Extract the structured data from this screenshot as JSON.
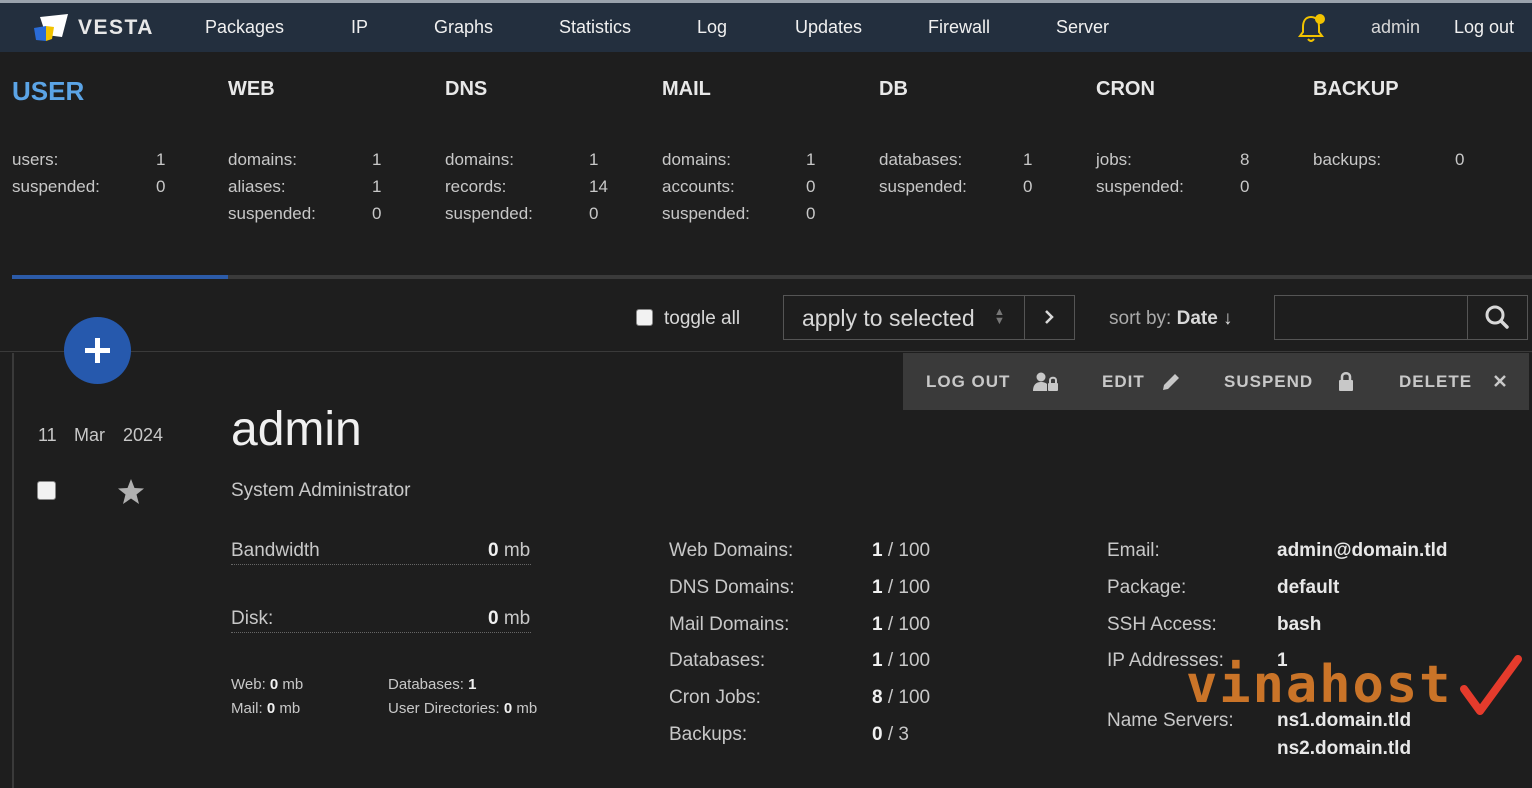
{
  "nav": {
    "logo_text": "VESTA",
    "items": [
      "Packages",
      "IP",
      "Graphs",
      "Statistics",
      "Log",
      "Updates",
      "Firewall",
      "Server"
    ],
    "user": "admin",
    "logout": "Log out"
  },
  "stats": {
    "user": {
      "title": "USER",
      "rows": [
        {
          "label": "users:",
          "value": "1"
        },
        {
          "label": "suspended:",
          "value": "0"
        }
      ]
    },
    "web": {
      "title": "WEB",
      "rows": [
        {
          "label": "domains:",
          "value": "1"
        },
        {
          "label": "aliases:",
          "value": "1"
        },
        {
          "label": "suspended:",
          "value": "0"
        }
      ]
    },
    "dns": {
      "title": "DNS",
      "rows": [
        {
          "label": "domains:",
          "value": "1"
        },
        {
          "label": "records:",
          "value": "14"
        },
        {
          "label": "suspended:",
          "value": "0"
        }
      ]
    },
    "mail": {
      "title": "MAIL",
      "rows": [
        {
          "label": "domains:",
          "value": "1"
        },
        {
          "label": "accounts:",
          "value": "0"
        },
        {
          "label": "suspended:",
          "value": "0"
        }
      ]
    },
    "db": {
      "title": "DB",
      "rows": [
        {
          "label": "databases:",
          "value": "1"
        },
        {
          "label": "suspended:",
          "value": "0"
        }
      ]
    },
    "cron": {
      "title": "CRON",
      "rows": [
        {
          "label": "jobs:",
          "value": "8"
        },
        {
          "label": "suspended:",
          "value": "0"
        }
      ]
    },
    "backup": {
      "title": "BACKUP",
      "rows": [
        {
          "label": "backups:",
          "value": "0"
        }
      ]
    }
  },
  "toolbar": {
    "toggle_all": "toggle all",
    "apply_selected": "apply to selected",
    "sort_prefix": "sort by:",
    "sort_field": "Date ↓",
    "search_placeholder": ""
  },
  "actions": {
    "logout": "LOG OUT",
    "edit": "EDIT",
    "suspend": "SUSPEND",
    "delete": "DELETE"
  },
  "user": {
    "date_day": "11",
    "date_month": "Mar",
    "date_year": "2024",
    "name": "admin",
    "role": "System Administrator",
    "bandwidth_label": "Bandwidth",
    "bandwidth_value": "0",
    "bandwidth_unit": " mb",
    "disk_label": "Disk:",
    "disk_value": "0",
    "disk_unit": " mb",
    "web_label": "Web:",
    "web_value": "0",
    "web_unit": " mb",
    "mail_label": "Mail:",
    "mail_value": "0",
    "mail_unit": " mb",
    "databases_label": "Databases:",
    "databases_value": "1",
    "userdirs_label": "User Directories:",
    "userdirs_value": "0",
    "userdirs_unit": " mb",
    "quotas": [
      {
        "label": "Web Domains:",
        "used": "1",
        "limit": " / 100"
      },
      {
        "label": "DNS Domains:",
        "used": "1",
        "limit": " / 100"
      },
      {
        "label": "Mail Domains:",
        "used": "1",
        "limit": " / 100"
      },
      {
        "label": "Databases:",
        "used": "1",
        "limit": " / 100"
      },
      {
        "label": "Cron Jobs:",
        "used": "8",
        "limit": " / 100"
      },
      {
        "label": "Backups:",
        "used": "0",
        "limit": " / 3"
      }
    ],
    "info": [
      {
        "label": "Email:",
        "value": "admin@domain.tld"
      },
      {
        "label": "Package:",
        "value": "default"
      },
      {
        "label": "SSH Access:",
        "value": "bash"
      },
      {
        "label": "IP Addresses:",
        "value": "1"
      }
    ],
    "ns_label": "Name Servers:",
    "ns": [
      "ns1.domain.tld",
      "ns2.domain.tld"
    ]
  },
  "watermark": "vinahost",
  "colors": {
    "nav_bg": "#232f3e",
    "accent_blue": "#2659ad",
    "active_title": "#5ba4e6",
    "bell": "#f2c300",
    "watermark": "#e8842a"
  }
}
